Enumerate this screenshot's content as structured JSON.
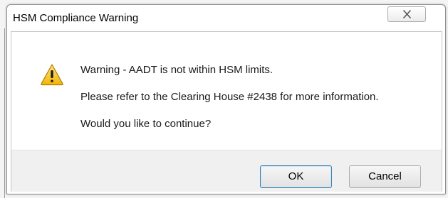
{
  "window": {
    "title": "HSM Compliance Warning",
    "close_icon": "close-icon"
  },
  "dialog": {
    "icon": "warning-icon",
    "icon_color": "#f5c400",
    "lines": [
      "Warning - AADT is not within HSM limits.",
      "Please refer to the Clearing House #2438 for more information.",
      "Would you like to continue?"
    ]
  },
  "buttons": {
    "ok_label": "OK",
    "cancel_label": "Cancel"
  }
}
